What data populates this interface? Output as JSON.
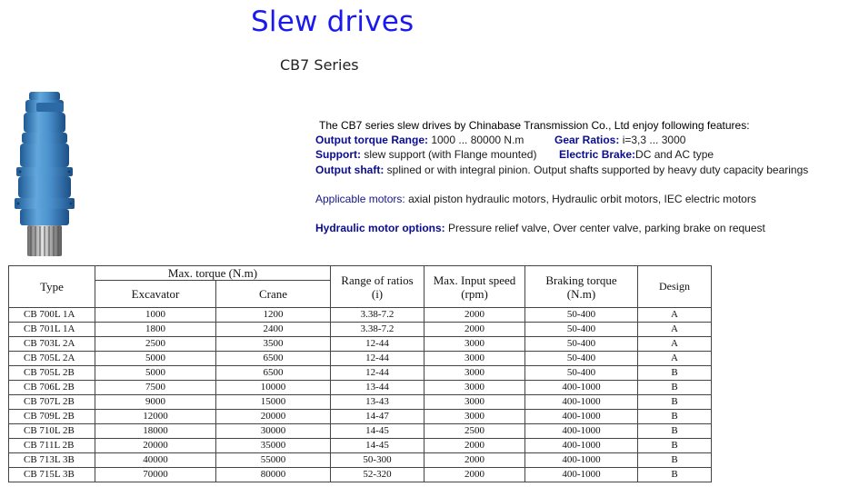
{
  "title": "Slew drives",
  "subtitle": "CB7 Series",
  "intro": "The CB7 series slew drives by Chinabase Transmission Co., Ltd enjoy following features:",
  "features": {
    "torque_label": "Output torque Range:",
    "torque_value": "1000 ... 80000 N.m",
    "ratio_label": "Gear Ratios:",
    "ratio_value": "i=3,3 ... 3000",
    "support_label": "Support:",
    "support_value_a": "slew support (with",
    "support_value_b": "Flange mounted)",
    "brake_label": "Electric Brake:",
    "brake_value": "DC and AC type",
    "shaft_label": "Output shaft:",
    "shaft_value": "splined or with integral pinion. Output shafts supported by heavy duty capacity bearings",
    "motors_label": "Applicable motors:",
    "motors_value": "axial piston hydraulic motors, Hydraulic orbit motors, IEC electric motors",
    "options_label": "Hydraulic motor options:",
    "options_value": "Pressure relief valve, Over center valve, parking brake on request"
  },
  "colors": {
    "title": "#1a1aee",
    "label": "#0b0b8f",
    "product_blue": "#3f86c4"
  },
  "table": {
    "headers": {
      "type": "Type",
      "torque": "Max. torque (N.m)",
      "excavator": "Excavator",
      "crane": "Crane",
      "ratio_a": "Range of ratios",
      "ratio_b": "(i)",
      "speed_a": "Max. Input speed",
      "speed_b": "(rpm)",
      "braking_a": "Braking torque",
      "braking_b": "(N.m)",
      "design": "Design"
    },
    "rows": [
      [
        "CB 700L 1A",
        "1000",
        "1200",
        "3.38-7.2",
        "2000",
        "50-400",
        "A"
      ],
      [
        "CB 701L 1A",
        "1800",
        "2400",
        "3.38-7.2",
        "2000",
        "50-400",
        "A"
      ],
      [
        "CB 703L 2A",
        "2500",
        "3500",
        "12-44",
        "3000",
        "50-400",
        "A"
      ],
      [
        "CB 705L 2A",
        "5000",
        "6500",
        "12-44",
        "3000",
        "50-400",
        "A"
      ],
      [
        "CB 705L 2B",
        "5000",
        "6500",
        "12-44",
        "3000",
        "50-400",
        "B"
      ],
      [
        "CB 706L 2B",
        "7500",
        "10000",
        "13-44",
        "3000",
        "400-1000",
        "B"
      ],
      [
        "CB 707L 2B",
        "9000",
        "15000",
        "13-43",
        "3000",
        "400-1000",
        "B"
      ],
      [
        "CB 709L 2B",
        "12000",
        "20000",
        "14-47",
        "3000",
        "400-1000",
        "B"
      ],
      [
        "CB 710L 2B",
        "18000",
        "30000",
        "14-45",
        "2500",
        "400-1000",
        "B"
      ],
      [
        "CB 711L 2B",
        "20000",
        "35000",
        "14-45",
        "2000",
        "400-1000",
        "B"
      ],
      [
        "CB 713L 3B",
        "40000",
        "55000",
        "50-300",
        "2000",
        "400-1000",
        "B"
      ],
      [
        "CB 715L 3B",
        "70000",
        "80000",
        "52-320",
        "2000",
        "400-1000",
        "B"
      ]
    ]
  }
}
